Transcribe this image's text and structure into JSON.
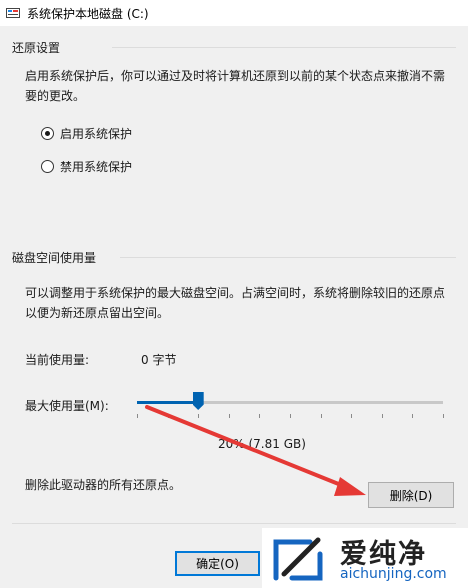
{
  "window": {
    "title": "系统保护本地磁盘 (C:)",
    "icon": "drive-settings-icon"
  },
  "restore": {
    "title": "还原设置",
    "description_line1": "启用系统保护后，你可以通过及时将计算机还原到以前的某个状态点来撤消不需",
    "description_line2": "要的更改。",
    "options": [
      {
        "label": "启用系统保护",
        "checked": true
      },
      {
        "label": "禁用系统保护",
        "checked": false
      }
    ]
  },
  "disk": {
    "title": "磁盘空间使用量",
    "description_line1": "可以调整用于系统保护的最大磁盘空间。占满空间时，系统将删除较旧的还原点",
    "description_line2": "以便为新还原点留出空间。",
    "current_label": "当前使用量:",
    "current_value": "0 字节",
    "max_label": "最大使用量(M):",
    "max_fraction": 0.2,
    "max_value_text": "20% (7.81 GB)",
    "delete_text": "删除此驱动器的所有还原点。",
    "delete_button": "删除(D)"
  },
  "buttons": {
    "ok": "确定(O)"
  },
  "annotation": {
    "arrow_color": "#e53935"
  },
  "watermark": {
    "brand": "爱纯净",
    "url": "aichunjing.com",
    "accent": "#1565c0"
  }
}
